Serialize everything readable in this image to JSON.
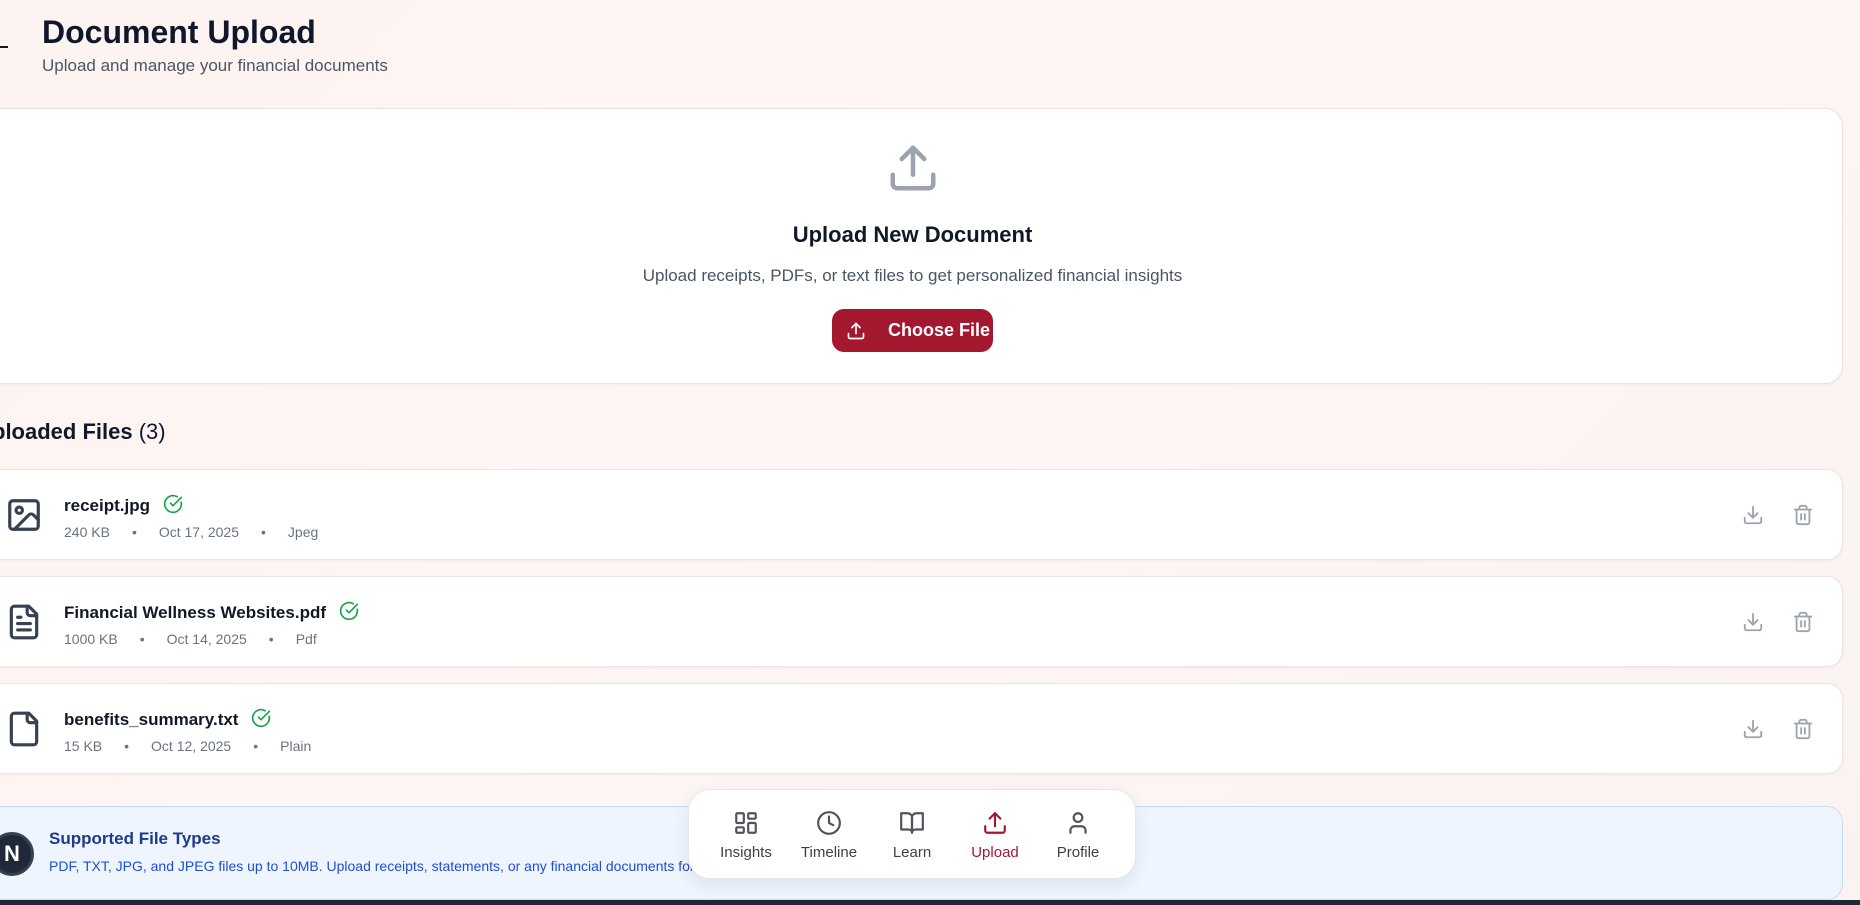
{
  "header": {
    "title": "Document Upload",
    "subtitle": "Upload and manage your financial documents"
  },
  "upload": {
    "title": "Upload New Document",
    "description": "Upload receipts, PDFs, or text files to get personalized financial insights",
    "button_label": "Choose File"
  },
  "files": {
    "heading": "ploaded Files",
    "count": "(3)",
    "items": [
      {
        "name": "receipt.jpg",
        "size": "240 KB",
        "date": "Oct 17, 2025",
        "type": "Jpeg",
        "icon": "image-file-icon"
      },
      {
        "name": "Financial Wellness Websites.pdf",
        "size": "1000 KB",
        "date": "Oct 14, 2025",
        "type": "Pdf",
        "icon": "document-file-icon"
      },
      {
        "name": "benefits_summary.txt",
        "size": "15 KB",
        "date": "Oct 12, 2025",
        "type": "Plain",
        "icon": "blank-file-icon"
      }
    ],
    "separator": "•"
  },
  "supported": {
    "title": "Supported File Types",
    "description": "PDF, TXT, JPG, and JPEG files up to 10MB. Upload receipts, statements, or any financial documents for AI-powered insights."
  },
  "avatar_letter": "N",
  "nav": {
    "items": [
      {
        "label": "Insights",
        "icon": "grid-icon"
      },
      {
        "label": "Timeline",
        "icon": "clock-icon"
      },
      {
        "label": "Learn",
        "icon": "book-icon"
      },
      {
        "label": "Upload",
        "icon": "upload-icon"
      },
      {
        "label": "Profile",
        "icon": "user-icon"
      }
    ],
    "active": "Upload"
  },
  "colors": {
    "accent": "#a3172f",
    "success": "#16a34a",
    "icon_gray": "#9ca3af"
  }
}
